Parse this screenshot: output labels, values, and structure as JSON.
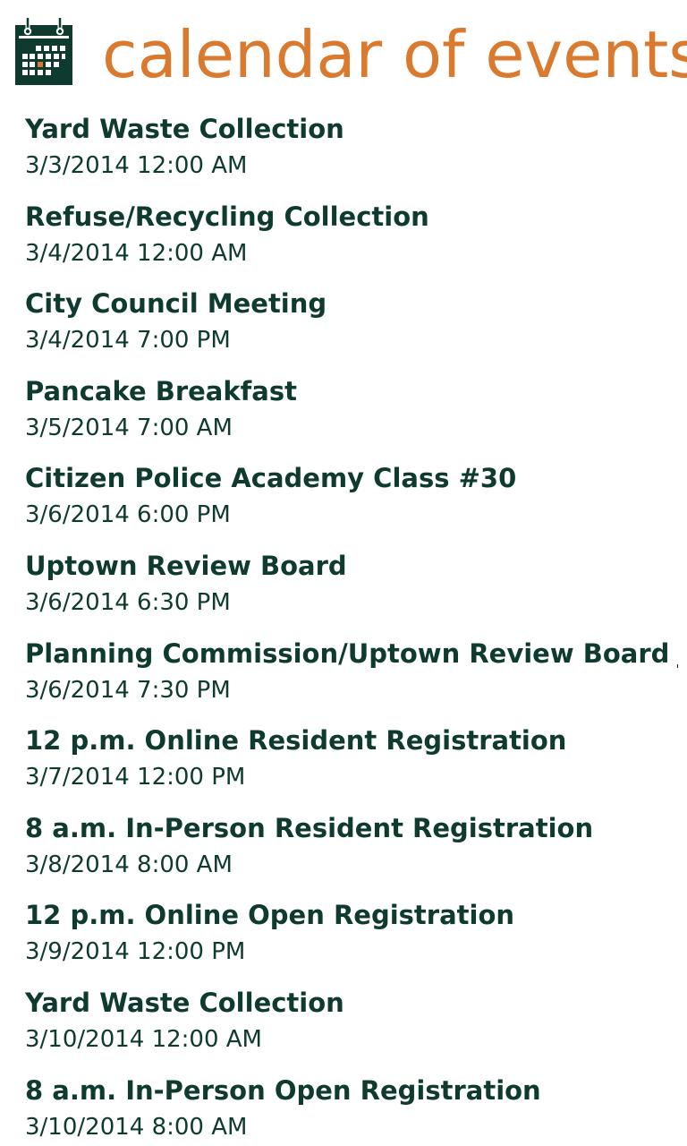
{
  "header": {
    "title": "calendar of events",
    "icon": "calendar-icon",
    "title_color": "#d97a2e",
    "icon_color": "#0e3a2f"
  },
  "events": [
    {
      "title": "Yard Waste Collection",
      "date": "3/3/2014 12:00 AM"
    },
    {
      "title": "Refuse/Recycling Collection",
      "date": "3/4/2014 12:00 AM"
    },
    {
      "title": "City Council Meeting",
      "date": "3/4/2014 7:00 PM"
    },
    {
      "title": "Pancake Breakfast",
      "date": "3/5/2014 7:00 AM"
    },
    {
      "title": "Citizen Police Academy Class #30",
      "date": "3/6/2014 6:00 PM"
    },
    {
      "title": "Uptown Review Board",
      "date": "3/6/2014 6:30 PM"
    },
    {
      "title": "Planning Commission/Uptown Review Board Jo",
      "date": "3/6/2014 7:30 PM"
    },
    {
      "title": "12 p.m. Online Resident Registration",
      "date": "3/7/2014 12:00 PM"
    },
    {
      "title": "8 a.m. In-Person Resident Registration",
      "date": "3/8/2014 8:00 AM"
    },
    {
      "title": "12 p.m. Online Open Registration",
      "date": "3/9/2014 12:00 PM"
    },
    {
      "title": "Yard Waste Collection",
      "date": "3/10/2014 12:00 AM"
    },
    {
      "title": "8 a.m. In-Person Open Registration",
      "date": "3/10/2014 8:00 AM"
    }
  ]
}
